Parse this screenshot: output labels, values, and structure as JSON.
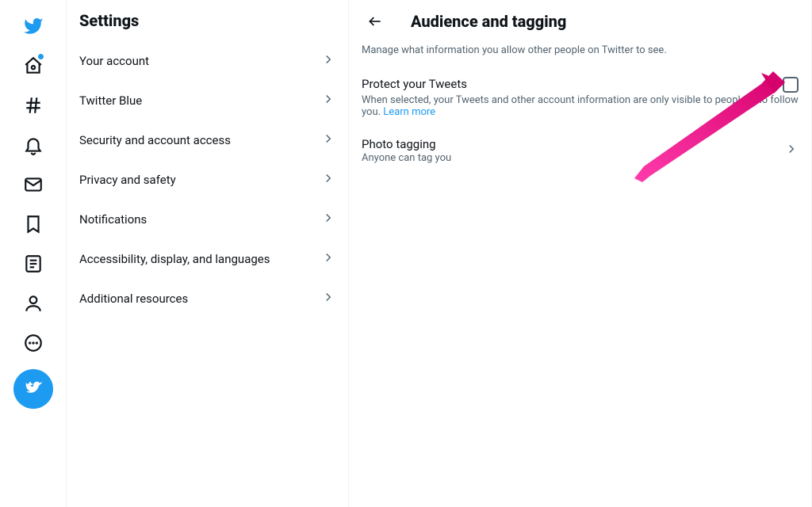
{
  "settings": {
    "title": "Settings",
    "items": [
      {
        "label": "Your account"
      },
      {
        "label": "Twitter Blue"
      },
      {
        "label": "Security and account access"
      },
      {
        "label": "Privacy and safety"
      },
      {
        "label": "Notifications"
      },
      {
        "label": "Accessibility, display, and languages"
      },
      {
        "label": "Additional resources"
      }
    ]
  },
  "detail": {
    "title": "Audience and tagging",
    "description": "Manage what information you allow other people on Twitter to see.",
    "protect_title": "Protect your Tweets",
    "protect_desc_a": "When selected, your Tweets and other account information are only visible to people who follow you. ",
    "learn_more": "Learn more",
    "photo_title": "Photo tagging",
    "photo_sub": "Anyone can tag you"
  }
}
